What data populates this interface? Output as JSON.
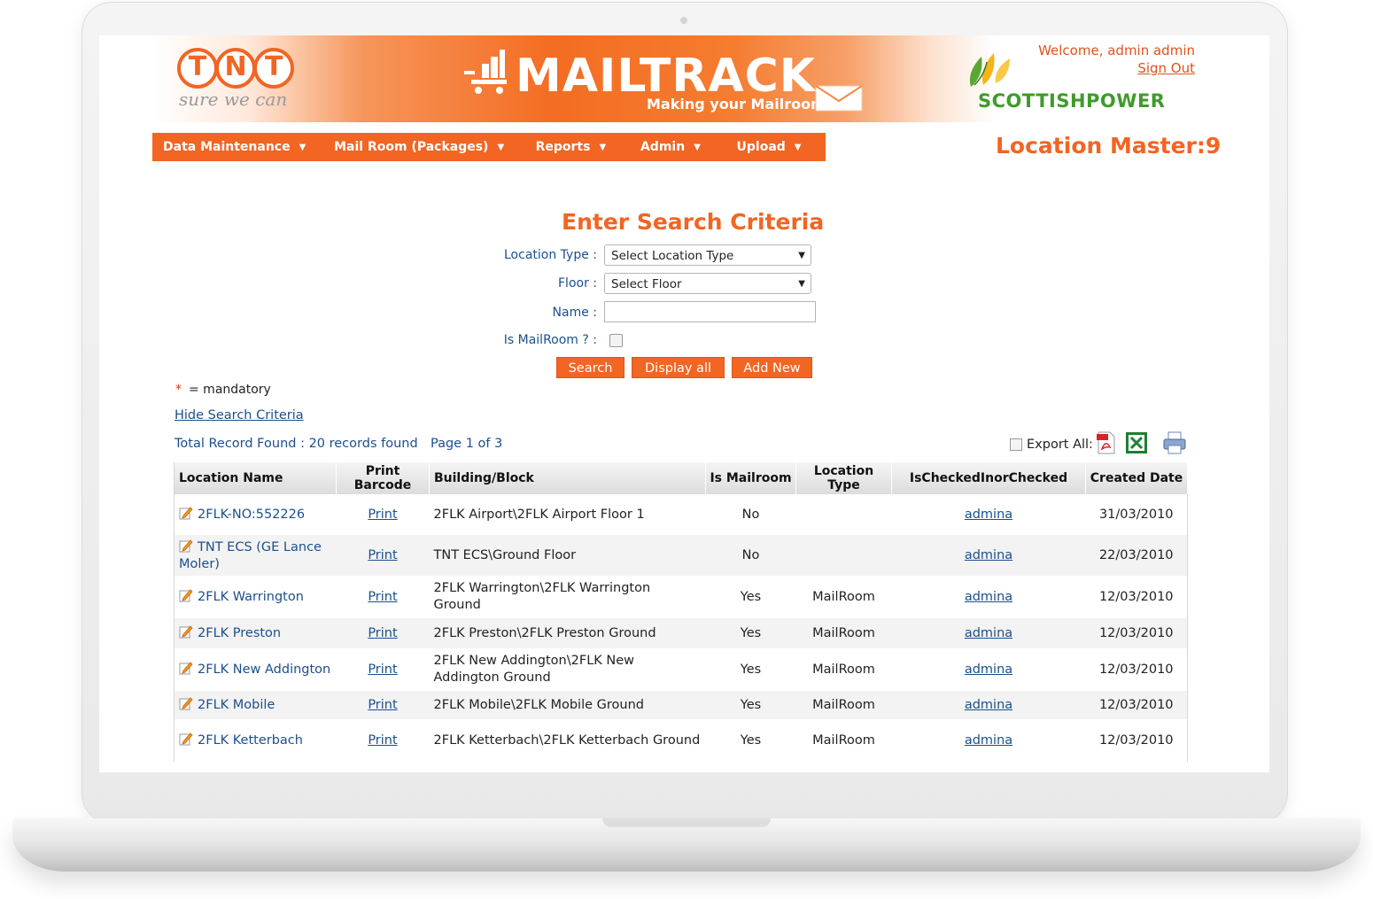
{
  "header": {
    "brand_initials": [
      "T",
      "N",
      "T"
    ],
    "brand_tagline": "sure we can",
    "app_title": "MAILTRACK",
    "app_subtitle": "Making your Mailroom",
    "welcome": "Welcome, admin admin",
    "sign_out": "Sign Out",
    "client_logo": "SCOTTISHPOWER",
    "page_heading": "Location Master:9"
  },
  "nav": [
    {
      "label": "Data Maintenance"
    },
    {
      "label": "Mail Room (Packages)"
    },
    {
      "label": "Reports"
    },
    {
      "label": "Admin"
    },
    {
      "label": "Upload"
    }
  ],
  "search": {
    "title": "Enter Search Criteria",
    "location_type_label": "Location Type :",
    "location_type_value": "Select Location Type",
    "floor_label": "Floor :",
    "floor_value": "Select Floor",
    "name_label": "Name :",
    "name_value": "",
    "is_mailroom_label": "Is MailRoom ? :",
    "is_mailroom_checked": false,
    "search_btn": "Search",
    "display_all_btn": "Display all",
    "add_new_btn": "Add New"
  },
  "mandatory_star": "*",
  "mandatory_note": "= mandatory",
  "hide_search": "Hide Search Criteria",
  "records_found": "Total Record Found : 20 records found",
  "page_info": "Page 1 of 3",
  "export_label": "Export All:",
  "icons": {
    "pdf": "pdf-icon",
    "excel": "excel-icon",
    "print": "printer-icon",
    "edit": "pencil-edit-icon"
  },
  "colors": {
    "accent": "#f26522",
    "link": "#1b4f8c",
    "client_green": "#3f9b2a"
  },
  "table": {
    "headers": [
      "Location Name",
      "Print Barcode",
      "Building/Block",
      "Is Mailroom",
      "Location Type",
      "IsCheckedInorChecked",
      "Created Date"
    ],
    "rows": [
      {
        "name": "2FLK-NO:552226",
        "print": "Print",
        "building": "2FLK Airport\\2FLK Airport Floor 1",
        "mailroom": "No",
        "type": "",
        "checked": "admina",
        "date": "31/03/2010"
      },
      {
        "name": "TNT ECS (GE Lance Moler)",
        "print": "Print",
        "building": "TNT ECS\\Ground Floor",
        "mailroom": "No",
        "type": "",
        "checked": "admina",
        "date": "22/03/2010"
      },
      {
        "name": "2FLK Warrington",
        "print": "Print",
        "building": "2FLK Warrington\\2FLK Warrington Ground",
        "mailroom": "Yes",
        "type": "MailRoom",
        "checked": "admina",
        "date": "12/03/2010"
      },
      {
        "name": "2FLK Preston",
        "print": "Print",
        "building": "2FLK Preston\\2FLK Preston Ground",
        "mailroom": "Yes",
        "type": "MailRoom",
        "checked": "admina",
        "date": "12/03/2010"
      },
      {
        "name": "2FLK New Addington",
        "print": "Print",
        "building": "2FLK New Addington\\2FLK New Addington Ground",
        "mailroom": "Yes",
        "type": "MailRoom",
        "checked": "admina",
        "date": "12/03/2010"
      },
      {
        "name": "2FLK Mobile",
        "print": "Print",
        "building": "2FLK Mobile\\2FLK Mobile Ground",
        "mailroom": "Yes",
        "type": "MailRoom",
        "checked": "admina",
        "date": "12/03/2010"
      },
      {
        "name": "2FLK Ketterbach",
        "print": "Print",
        "building": "2FLK Ketterbach\\2FLK Ketterbach Ground",
        "mailroom": "Yes",
        "type": "MailRoom",
        "checked": "admina",
        "date": "12/03/2010"
      }
    ]
  }
}
